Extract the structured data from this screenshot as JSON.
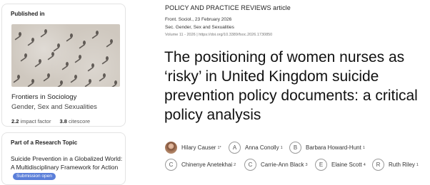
{
  "sidebar": {
    "journal_card": {
      "label": "Published in",
      "journal_name": "Frontiers in Sociology",
      "section": "Gender, Sex and Sexualities",
      "impact_factor_value": "2.2",
      "impact_factor_label": "impact factor",
      "citescore_value": "3.8",
      "citescore_label": "citescore"
    },
    "topic_card": {
      "label": "Part of a Research Topic",
      "title": "Suicide Prevention in a Globalized World: A Multidisciplinary Framework for Action",
      "badge": "Submission open"
    }
  },
  "article": {
    "type": "POLICY AND PRACTICE REVIEWS article",
    "journal_date": "Front. Sociol., 23 February 2026",
    "section": "Sec. Gender, Sex and Sexualities",
    "volume_doi": "Volume 11 - 2026 | https://doi.org/10.3389/fsoc.2026.1730850",
    "title": "The positioning of women nurses as ‘risky’ in United Kingdom suicide prevention policy documents: a critical policy analysis"
  },
  "authors": [
    {
      "name": "Hilary Causer",
      "sup": "1*",
      "initial": "",
      "photo": true
    },
    {
      "name": "Anna Conolly",
      "sup": "1",
      "initial": "A"
    },
    {
      "name": "Barbara Howard-Hunt",
      "sup": "1",
      "initial": "B"
    },
    {
      "name": "Chinenye Anetekhai",
      "sup": "2",
      "initial": "C"
    },
    {
      "name": "Carrie-Ann Black",
      "sup": "3",
      "initial": "C"
    },
    {
      "name": "Elaine Scott",
      "sup": "4",
      "initial": "E"
    },
    {
      "name": "Ruth Riley",
      "sup": "1",
      "initial": "R"
    }
  ]
}
